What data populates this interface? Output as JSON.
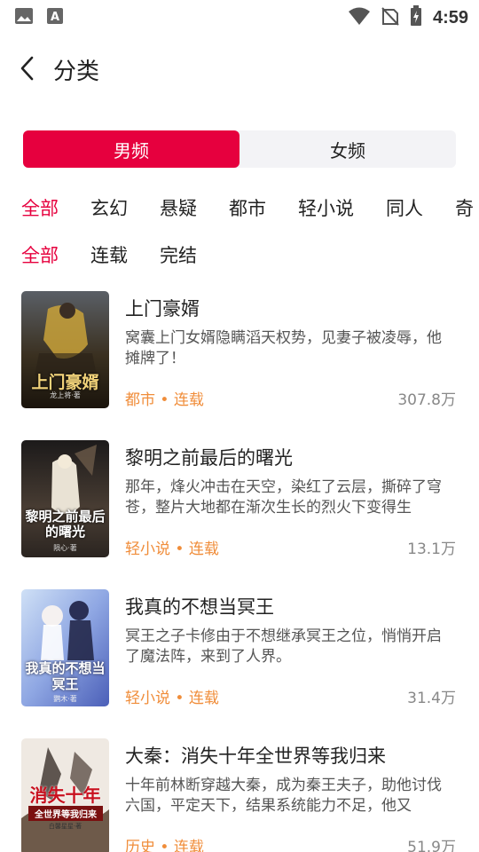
{
  "status_bar": {
    "time": "4:59",
    "left_icons": [
      "image-icon",
      "font-a-icon"
    ],
    "right_icons": [
      "wifi-icon",
      "no-signal-icon",
      "battery-charging-icon"
    ]
  },
  "header": {
    "back_icon": "chevron-left-icon",
    "title": "分类"
  },
  "gender_tabs": [
    {
      "label": "男频",
      "active": true
    },
    {
      "label": "女频",
      "active": false
    }
  ],
  "categories": [
    {
      "label": "全部",
      "active": true
    },
    {
      "label": "玄幻",
      "active": false
    },
    {
      "label": "悬疑",
      "active": false
    },
    {
      "label": "都市",
      "active": false
    },
    {
      "label": "轻小说",
      "active": false
    },
    {
      "label": "同人",
      "active": false
    },
    {
      "label": "奇",
      "active": false
    }
  ],
  "status_filters": [
    {
      "label": "全部",
      "active": true
    },
    {
      "label": "连载",
      "active": false
    },
    {
      "label": "完结",
      "active": false
    }
  ],
  "books": [
    {
      "title": "上门豪婿",
      "desc": "窝囊上门女婿隐瞒滔天权势，见妻子被凌辱，他摊牌了！",
      "meta": "都市 • 连载",
      "count": "307.8万",
      "cover_title": "上门豪婿",
      "cover_author": "龙上将·著"
    },
    {
      "title": "黎明之前最后的曙光",
      "desc": "那年，烽火冲击在天空，染红了云层，撕碎了穹苍，整片大地都在渐次生长的烈火下变得生",
      "meta": "轻小说 • 连载",
      "count": "13.1万",
      "cover_title": "黎明之前最后的曙光",
      "cover_author": "陨心·著"
    },
    {
      "title": "我真的不想当冥王",
      "desc": "冥王之子卡修由于不想继承冥王之位，悄悄开启了魔法阵，来到了人界。",
      "meta": "轻小说 • 连载",
      "count": "31.4万",
      "cover_title": "我真的不想当冥王",
      "cover_author": "鹦木·著"
    },
    {
      "title": "大秦：消失十年全世界等我归来",
      "desc": "十年前林断穿越大秦，成为秦王夫子，助他讨伐六国，平定天下，结果系统能力不足，他又",
      "meta": "历史 • 连载",
      "count": "51.9万",
      "cover_title": "消失十年",
      "cover_sub": "全世界等我归来",
      "cover_author": "白馨星星·著"
    }
  ],
  "colors": {
    "accent": "#e6003e",
    "meta": "#f08d3a",
    "segment_bg": "#f3f3f6"
  }
}
